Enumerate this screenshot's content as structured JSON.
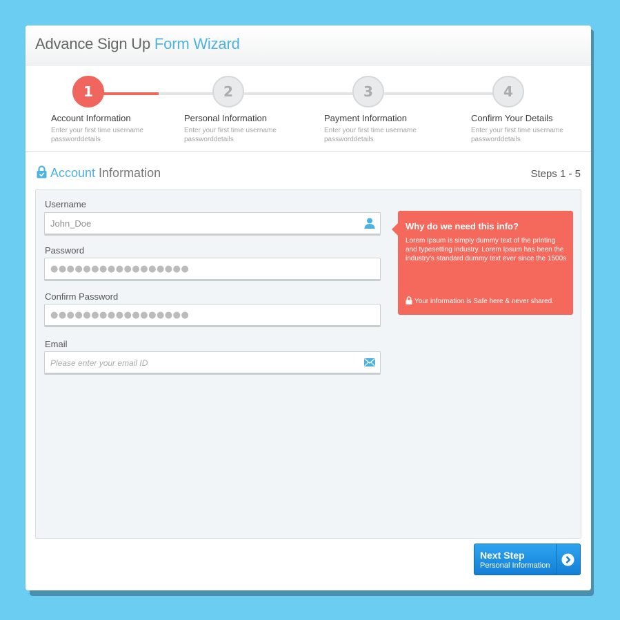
{
  "header": {
    "title_prefix": "Advance Sign Up",
    "title_highlight": "Form Wizard"
  },
  "wizard": {
    "steps": [
      {
        "number": "1",
        "title": "Account Information",
        "desc": "Enter your first time username passworddetails",
        "active": true
      },
      {
        "number": "2",
        "title": "Personal Information",
        "desc": "Enter your first time username passworddetails",
        "active": false
      },
      {
        "number": "3",
        "title": "Payment Information",
        "desc": "Enter your first time username passworddetails",
        "active": false
      },
      {
        "number": "4",
        "title": "Confirm Your Details",
        "desc": "Enter your first time username passworddetails",
        "active": false
      }
    ],
    "progress_fraction": 0.5
  },
  "section": {
    "title_highlight": "Account",
    "title_rest": " Information",
    "steps_count": "Steps 1 - 5"
  },
  "form": {
    "username": {
      "label": "Username",
      "value": "John_Doe",
      "icon": "user-icon"
    },
    "password": {
      "label": "Password",
      "value": "●●●●●●●●●●●●●●●●●"
    },
    "confirm_password": {
      "label": "Confirm Password",
      "value": "●●●●●●●●●●●●●●●●●"
    },
    "email": {
      "label": "Email",
      "placeholder": "Please enter your email ID",
      "icon": "envelope-icon"
    }
  },
  "tooltip": {
    "title": "Why do we need this info?",
    "body": "Lorem Ipsum is simply dummy text of the printing and typesetting industry. Lorem Ipsum has been the industry's standard dummy text ever since the 1500s",
    "note": "Your information is Safe here & never shared."
  },
  "next_button": {
    "label": "Next Step",
    "sublabel": "Personal Information",
    "icon": "chevron-right-icon"
  },
  "colors": {
    "background": "#6acdf1",
    "accent_blue": "#4cb3e1",
    "accent_red": "#f0655d",
    "button_blue": "#1a8fe0"
  }
}
